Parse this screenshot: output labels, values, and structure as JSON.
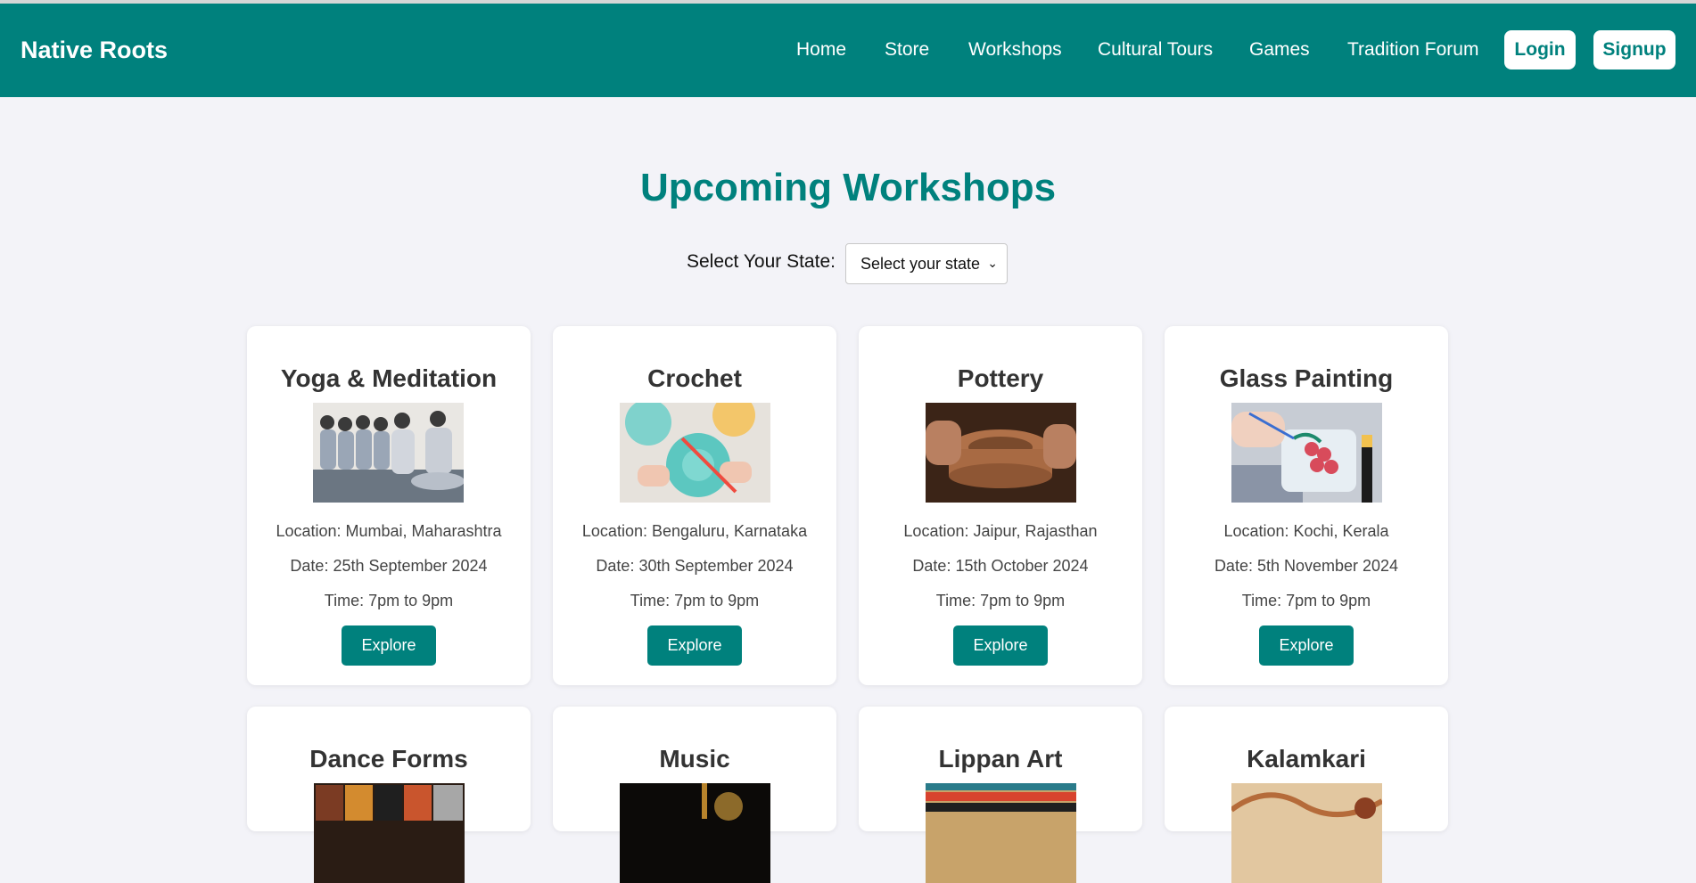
{
  "navbar": {
    "brand": "Native Roots",
    "links": [
      "Home",
      "Store",
      "Workshops",
      "Cultural Tours",
      "Games",
      "Tradition Forum"
    ],
    "login_label": "Login",
    "signup_label": "Signup"
  },
  "main": {
    "heading": "Upcoming Workshops",
    "state_label": "Select Your State:",
    "state_select_value": "Select your state"
  },
  "workshops": [
    {
      "title": "Yoga & Meditation",
      "location": "Location: Mumbai, Maharashtra",
      "date": "Date: 25th September 2024",
      "time": "Time: 7pm to 9pm",
      "button": "Explore"
    },
    {
      "title": "Crochet",
      "location": "Location: Bengaluru, Karnataka",
      "date": "Date: 30th September 2024",
      "time": "Time: 7pm to 9pm",
      "button": "Explore"
    },
    {
      "title": "Pottery",
      "location": "Location: Jaipur, Rajasthan",
      "date": "Date: 15th October 2024",
      "time": "Time: 7pm to 9pm",
      "button": "Explore"
    },
    {
      "title": "Glass Painting",
      "location": "Location: Kochi, Kerala",
      "date": "Date: 5th November 2024",
      "time": "Time: 7pm to 9pm",
      "button": "Explore"
    },
    {
      "title": "Dance Forms"
    },
    {
      "title": "Music"
    },
    {
      "title": "Lippan Art"
    },
    {
      "title": "Kalamkari"
    }
  ],
  "colors": {
    "brand": "#00817d",
    "background": "#f3f3f8",
    "card": "#ffffff"
  }
}
